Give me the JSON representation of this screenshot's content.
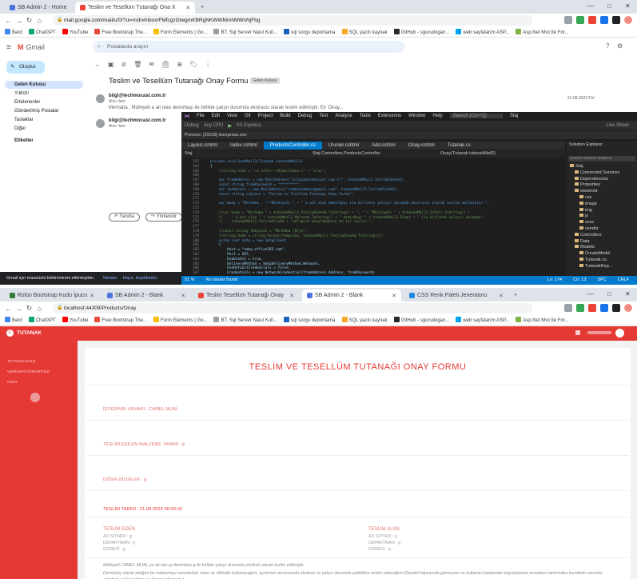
{
  "colors": {
    "app_accent": "#e53935",
    "vs_status": "#007acc",
    "gmail_compose": "#c2e7ff"
  },
  "win1": {
    "tabs": [
      {
        "label": "SB Admin 2 - Home"
      },
      {
        "label": "Teslim ve Tesellüm Tutanağı Ona X"
      }
    ],
    "url": "mail.google.com/mail/u/0/?ui=mdr#inbox/FMfcgzGtwgmKBRgNKWWMmhMWnNjFbg",
    "bookmarks": [
      "Bard",
      "ChatGPT",
      "YouTube",
      "Free Bootstrap The...",
      "Form Elements | Go...",
      "BT. Sql Server Nasıl Kull...",
      "sql sorgu deponlama",
      "SQL yazılı kaynak",
      "GitHub - sgurudogan...",
      "web sayfalarım ASP...",
      "Asp.Net Mvc'de For..."
    ],
    "gmail": {
      "app_name": "Gmail",
      "search_placeholder": "Postalarda arayın",
      "compose": "Oluştur",
      "side_items": [
        "Gelen Kutusu",
        "Yıldızlı",
        "Ertelenenler",
        "Gönderilmiş Postalar",
        "Taslaklar",
        "Diğer"
      ],
      "labels_header": "Etiketler",
      "subject": "Teslim ve Tesellüm Tutanağı Onay Formu",
      "inbox_badge": "Gelen Kutusu",
      "sender1": "bilgi@techmocast.com.tr",
      "to1": "Alıcı: ben",
      "body1": "Merhaba , Mülkiyeti a ait olan demirbaşı ile birlikte çalışır durumda ekstrasiz olarak teslim edilmiştir. Ek 'Onay...",
      "sender2": "bilgi@techmocast.com.tr",
      "to2": "Alıcı: ben",
      "reply": "Yanıtla",
      "forward": "Yönlendir",
      "toast": "Gmail için masaüstü bildirimlerini etkinleştirin.",
      "toast_ok": "Tamam",
      "toast_no": "Hayır, teşekkürler",
      "date": "21.08.2023 Pzt"
    },
    "vs": {
      "menu": [
        "File",
        "Edit",
        "View",
        "Git",
        "Project",
        "Build",
        "Debug",
        "Test",
        "Analyze",
        "Tools",
        "Extensions",
        "Window",
        "Help"
      ],
      "search": "Search (Ctrl+Q)",
      "project": "Staj",
      "toolbar": [
        "Debug",
        "Any CPU",
        "IIS Express",
        "Live Share"
      ],
      "process": "Process: [20018] iisexpress.exe",
      "tabs": [
        "Layout.cshtml",
        "Index.cshtml",
        "ProductsController.cs",
        "Urunler.cshtml",
        "Add.cshtml",
        "Onay.cshtml",
        "Tutanak.cs"
      ],
      "crumbs": [
        "Staj",
        "Staj.Controllers.ProductsController",
        "Onay(Tutanak tutanakMail2)"
      ],
      "line_numbers": [
        "163",
        "164",
        "165",
        "166",
        "167",
        "168",
        "169",
        "170",
        "171",
        "172",
        "173",
        "174",
        "175",
        "176",
        "177",
        "178",
        "179",
        "180",
        "181",
        "182",
        "183",
        "184",
        "185",
        "186",
        "187"
      ],
      "code_lines": [
        "private void SendMail2(Tutanak tutanakMail2)",
        "{",
        "    //string html = \"<a href='~/Home/Index'>\" + \"</a>\";",
        "",
        "    var fromAddress = new MailAddress(\"bilgi@techmocast.com.tr\", tutanakMail2.TeslimEdenAd);",
        "    const string fromPassword = \"********\";",
        "    var toAddress = new MailAddress(\"sedatozdemir@gmail.com\", tutanakMail2.TeslimAlanAd);",
        "    const string subject = \"Teslim ve Tesellüm Tutanağı Onay Formu\";",
        "",
        "    var body = \"Merhaba , \"+\"Mülkiyeti \" + \" a ait olan demirbaşı ile birlikte çalışır durumda ekstrasiz olarak teslim edilmiştir.\";",
        "",
        "    //var body = \"Merhaba \" + tutanakMail2.TeslimEdenAd.ToString() + \", \" + \"Mülkiyeti \" + tutanakMail2.IsYeri.ToString() +",
        "    //    \" a ait olan \" + tutanakMail2.Malzeme.ToString() + \" demirbaşı \" + tutanakMail2.Diger + \" ile birlikte çalışır durumda\";",
        "    //    tutanakMail2.TeslimAlanAd + \"adlıgına onaylamaktan en iyi sonlar.\";",
        "",
        "    //const string template = \"Merhaba {0}\\n\";",
        "    //string body = string.Format(template, tutanakMail2.TeslimAlanAd.ToString());",
        "    using (var smtp = new SmtpClient",
        "    {",
        "        Host = \"smtp.office365.com\",",
        "        Port = 587,",
        "        EnableSsl = true,",
        "        DeliveryMethod = SmtpDeliveryMethod.Network,",
        "        UseDefaultCredentials = false,",
        "        Credentials = new NetworkCredential(fromAddress.Address, fromPassword)"
      ],
      "status": [
        "51 %",
        "No issues found",
        "Ln: 174",
        "Ch: 13",
        "SPC",
        "CRLF"
      ],
      "solution_title": "Solution Explorer",
      "solution_search": "Search Solution Explorer",
      "solution_items": [
        "Staj",
        "Connected Services",
        "Dependencies",
        "Properties",
        "wwwroot",
        "css",
        "image",
        "img",
        "js",
        "scss",
        "vendor",
        "Controllers",
        "Data",
        "Models",
        "CreateModel",
        "Tutanak.cs",
        "TutanakRep..."
      ]
    }
  },
  "win2": {
    "tabs": [
      {
        "label": "Rolün Bootstrap Kodu İpucu"
      },
      {
        "label": "SB Admin 2 - Blank"
      },
      {
        "label": "Teslim Tesellüm Tutanağı Onay"
      },
      {
        "label": "SB Admin 2 - Blank"
      },
      {
        "label": "CSS Renk Paleti Jeneratoru"
      }
    ],
    "url": "localhost:44309/Products/Onay",
    "app": {
      "brand": "TUTANAK",
      "side_items": [
        "TUTANAK EKLE",
        "VERİLERİ GÖRÜNTÜLE",
        "ONAY"
      ],
      "title": "TESLİM VE TESELLÜM TUTANAĞI ONAY FORMU",
      "fields": [
        "İŞYERİNİN UNVANI : CAMEL MUAL",
        "TESLİM EDİLEN MALZEME TANIMI : g",
        "DİĞER BİLGİLER : g",
        "TESLİM TARİHİ : 21.08.2023 00:00:00"
      ],
      "col1_head": "TESLİM EDEN",
      "col1_vals": [
        "AD SOYADI : g",
        "DEPARTMAN : g",
        "GÖREVİ : g"
      ],
      "col2_head": "TESLİM ALAN",
      "col2_vals": [
        "AD SOYADI : g",
        "DEPARTMAN : g",
        "GÖREVİ : g"
      ],
      "para1": "Mülkiyeti CAMEL MUAL ye ait olan g demirbaşı g ile birlikte çalışır durumda eksiksiz olarak teslim edilmiştir.",
      "para2": "Demirbaş olarak aldığım bu malzemeyi sorumluluk, özen ve dikkatle kullanacağım, ayrılmam durumunda eksiksiz ve çalışır durumda yetkililere teslim edeceğimi (Gerekli kapsamda görmeyen ve kullanan hatalardan kaynaklanan arızaların tamirinden kendimin sorumlu olduğunu kabul ediyor ve beyan ediyorum.)"
    }
  }
}
